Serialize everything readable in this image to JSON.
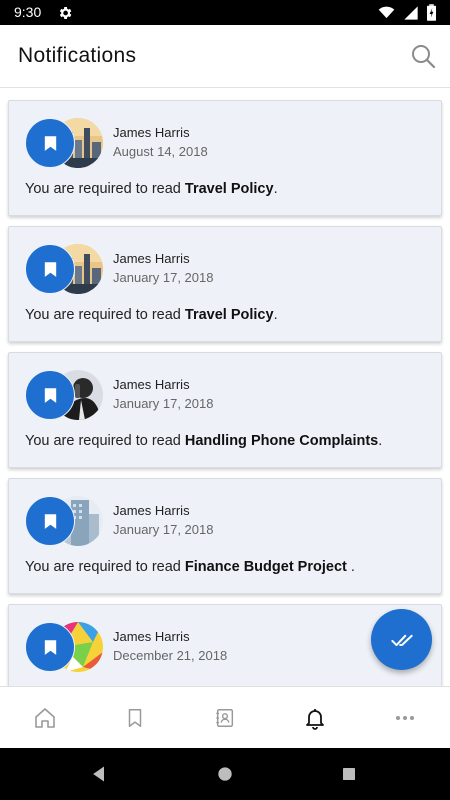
{
  "status_bar": {
    "time": "9:30",
    "icons": [
      "gear-icon",
      "wifi-icon",
      "signal-icon",
      "battery-icon"
    ]
  },
  "app_bar": {
    "title": "Notifications",
    "search_icon": "search-icon"
  },
  "notifications": [
    {
      "name": "James Harris",
      "date": "August 14, 2018",
      "message_prefix": "You are required to read ",
      "document": "Travel Policy",
      "message_suffix": ".",
      "photo": "city-skyline"
    },
    {
      "name": "James Harris",
      "date": "January 17, 2018",
      "message_prefix": "You are required to read ",
      "document": "Travel Policy",
      "message_suffix": ".",
      "photo": "city-skyline"
    },
    {
      "name": "James Harris",
      "date": "January 17, 2018",
      "message_prefix": "You are required to read ",
      "document": "Handling Phone Complaints",
      "message_suffix": ".",
      "photo": "person-on-phone"
    },
    {
      "name": "James Harris",
      "date": "January 17, 2018",
      "message_prefix": "You are required to read ",
      "document": "Finance Budget Project",
      "message_suffix": " .",
      "photo": "office-building"
    },
    {
      "name": "James Harris",
      "date": "December 21, 2018",
      "message_prefix": "",
      "document": "",
      "message_suffix": "",
      "photo": "colorful-abstract"
    }
  ],
  "fab": {
    "icon": "double-check-icon"
  },
  "bottom_nav": {
    "items": [
      "home-icon",
      "bookmark-icon",
      "contacts-icon",
      "bell-icon",
      "more-icon"
    ],
    "active": "bell-icon"
  },
  "colors": {
    "accent": "#1e6fd0",
    "card_bg": "#eef2f8",
    "text": "#222222",
    "muted": "#666666"
  }
}
